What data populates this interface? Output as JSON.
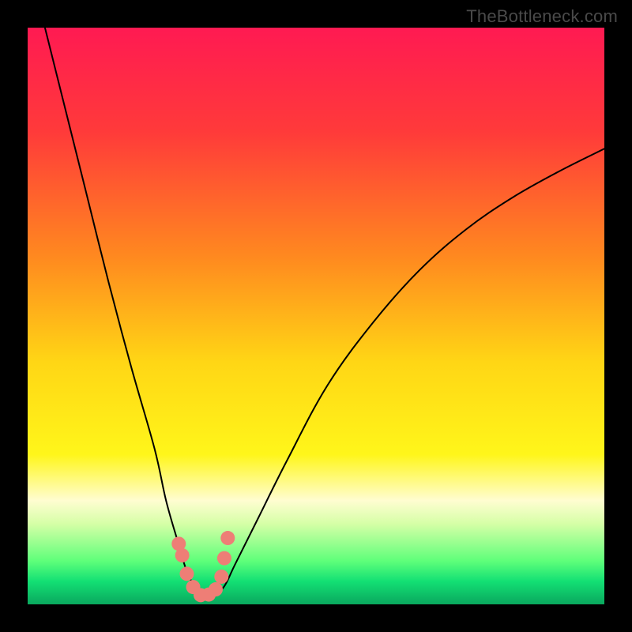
{
  "watermark": "TheBottleneck.com",
  "colors": {
    "frame": "#000000",
    "curve": "#000000",
    "marker": "#ee7e76",
    "gradient_stops": [
      {
        "offset": 0.0,
        "color": "#ff1a52"
      },
      {
        "offset": 0.18,
        "color": "#ff3a3a"
      },
      {
        "offset": 0.4,
        "color": "#ff8a1f"
      },
      {
        "offset": 0.58,
        "color": "#ffd615"
      },
      {
        "offset": 0.74,
        "color": "#fff61a"
      },
      {
        "offset": 0.82,
        "color": "#fffdd1"
      },
      {
        "offset": 0.86,
        "color": "#d6ffa7"
      },
      {
        "offset": 0.925,
        "color": "#5eff7a"
      },
      {
        "offset": 0.96,
        "color": "#13e074"
      },
      {
        "offset": 1.0,
        "color": "#0aa85e"
      }
    ]
  },
  "chart_data": {
    "type": "line",
    "title": "",
    "xlabel": "",
    "ylabel": "",
    "xlim": [
      0,
      100
    ],
    "ylim": [
      0,
      100
    ],
    "series": [
      {
        "name": "bottleneck-curve",
        "x": [
          3,
          6,
          10,
          14,
          18,
          22,
          24,
          26,
          27.5,
          29,
          30.5,
          32,
          34,
          36,
          40,
          45,
          52,
          60,
          68,
          76,
          84,
          92,
          100
        ],
        "y": [
          100,
          88,
          72,
          56,
          41,
          27,
          18,
          11,
          6,
          3,
          1.5,
          1.5,
          3,
          7,
          15,
          25,
          38,
          49,
          58,
          65,
          70.5,
          75,
          79
        ]
      }
    ],
    "markers": {
      "name": "highlight-points",
      "x": [
        26.2,
        26.8,
        27.6,
        28.7,
        30.0,
        31.4,
        32.6,
        33.6,
        34.1,
        34.7
      ],
      "y": [
        10.5,
        8.5,
        5.3,
        3.0,
        1.6,
        1.7,
        2.6,
        4.8,
        8.0,
        11.5
      ]
    }
  }
}
